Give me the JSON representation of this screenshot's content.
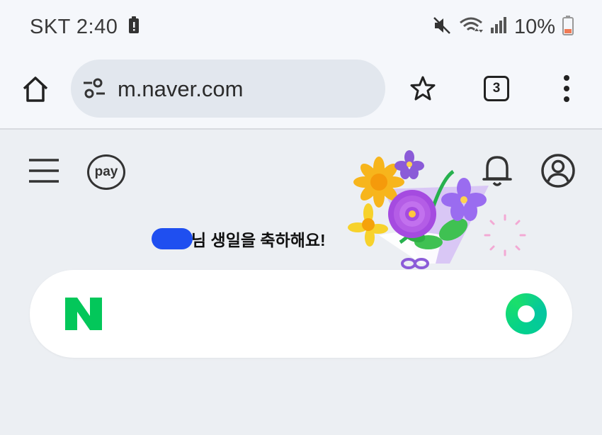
{
  "status_bar": {
    "carrier_time": "SKT 2:40",
    "battery_percent": "10%",
    "icons": [
      "alert-icon",
      "mute-icon",
      "wifi-icon",
      "signal-icon",
      "battery-icon"
    ]
  },
  "toolbar": {
    "url": "m.naver.com",
    "tab_count": "3",
    "icons": [
      "home-icon",
      "tune-icon",
      "star-icon",
      "more-icon"
    ]
  },
  "page": {
    "pay_label": "pay",
    "birthday_message": "님 생일을 축하해요!",
    "icons": [
      "hamburger-icon",
      "bell-icon",
      "profile-icon",
      "naver-n-logo",
      "green-search-lens-icon"
    ],
    "colors": {
      "naver_green": "#03c75a",
      "page_bg": "#eceff3",
      "redaction_blue": "#1f4ff0"
    }
  }
}
